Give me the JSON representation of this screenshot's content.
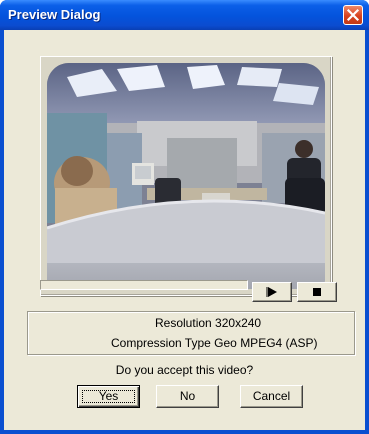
{
  "window": {
    "title": "Preview Dialog",
    "close_icon": "close-icon"
  },
  "video": {
    "content": "office webcam preview image",
    "progress": 0
  },
  "controls": {
    "play_icon": "play-icon",
    "stop_icon": "stop-icon"
  },
  "info": {
    "resolution_label": "Resolution",
    "resolution_value": "320x240",
    "compression_label": "Compression Type",
    "compression_value": "Geo MPEG4 (ASP)"
  },
  "prompt": "Do you accept this video?",
  "buttons": {
    "yes": "Yes",
    "no": "No",
    "cancel": "Cancel"
  },
  "colors": {
    "titlebar": "#0453dc",
    "dialog_bg": "#ece9d8",
    "close": "#d8431f"
  }
}
